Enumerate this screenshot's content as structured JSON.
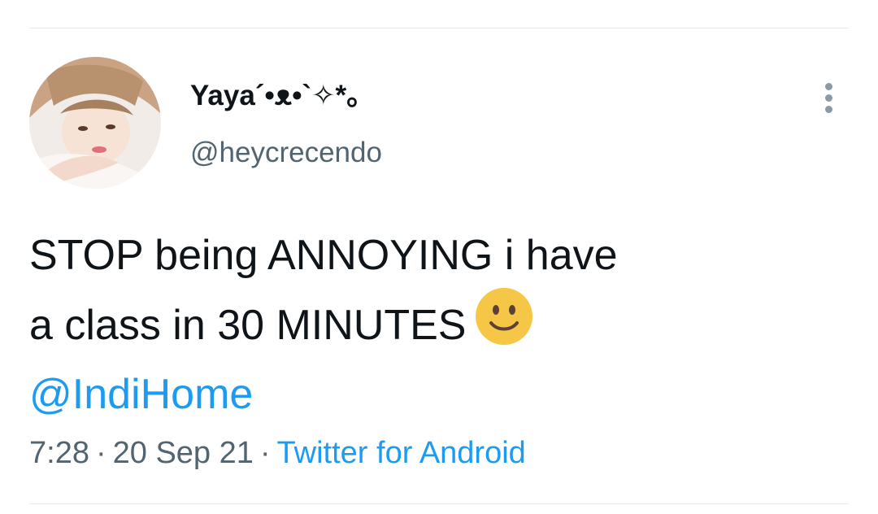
{
  "tweet": {
    "author": {
      "display_name": "Yaya´•ᴥ•`✧*。",
      "handle": "@heycrecendo"
    },
    "text_line_1": "STOP being ANNOYING i have",
    "text_line_2": "a class in 30 MINUTES",
    "emoji": "slightly-smiling-face",
    "mention": "@IndiHome",
    "time": "7:28",
    "separator": "·",
    "date": "20 Sep 21",
    "source": "Twitter for Android"
  },
  "icons": {
    "more": "more-vertical-icon"
  },
  "colors": {
    "link": "#1d9bf0",
    "secondary_text": "#536471",
    "primary_text": "#0f1419"
  }
}
